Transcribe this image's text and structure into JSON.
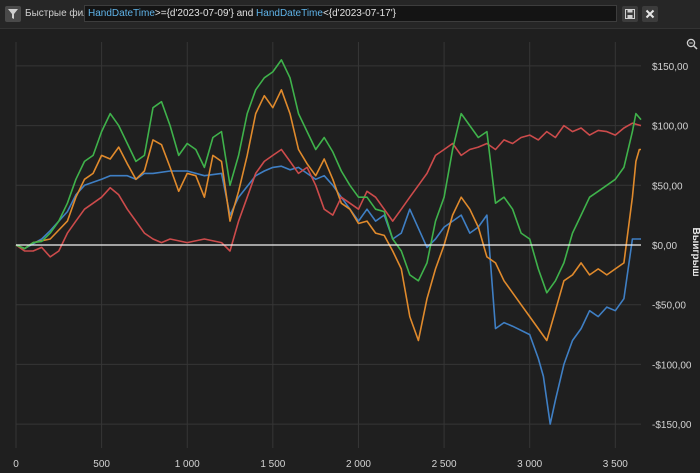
{
  "toolbar": {
    "filter_label": "Быстрые фильт",
    "query": {
      "field1": "HandDateTime",
      "op1": ">={d'2023-07-09'}",
      "conj": " and ",
      "field2": "HandDateTime",
      "op2": "<{d'2023-07-17'}"
    }
  },
  "icons": {
    "filter": "filter-icon",
    "save": "save-icon",
    "close": "close-icon",
    "zoom": "zoom-icon"
  },
  "chart_data": {
    "type": "line",
    "title": "",
    "xlabel": "",
    "ylabel": "Выигрыш",
    "xlim": [
      0,
      3650
    ],
    "ylim": [
      -170,
      170
    ],
    "grid": true,
    "x_ticks": [
      0,
      500,
      1000,
      1500,
      2000,
      2500,
      3000,
      3500
    ],
    "x_tick_labels": [
      "0",
      "500",
      "1 000",
      "1 500",
      "2 000",
      "2 500",
      "3 000",
      "3 500"
    ],
    "y_ticks": [
      150,
      100,
      50,
      0,
      -50,
      -100,
      -150
    ],
    "y_tick_labels": [
      "$150,00",
      "$100,00",
      "$50,00",
      "$0,00",
      "-$50,00",
      "-$100,00",
      "-$150,00"
    ],
    "zero_line": true,
    "series": [
      {
        "color": "#3f7fc4",
        "points": [
          [
            0,
            0
          ],
          [
            50,
            -3
          ],
          [
            150,
            5
          ],
          [
            200,
            12
          ],
          [
            300,
            28
          ],
          [
            350,
            42
          ],
          [
            400,
            50
          ],
          [
            500,
            55
          ],
          [
            550,
            58
          ],
          [
            650,
            58
          ],
          [
            700,
            55
          ],
          [
            750,
            60
          ],
          [
            800,
            60
          ],
          [
            900,
            62
          ],
          [
            1000,
            62
          ],
          [
            1100,
            58
          ],
          [
            1200,
            60
          ],
          [
            1250,
            25
          ],
          [
            1300,
            40
          ],
          [
            1400,
            58
          ],
          [
            1450,
            62
          ],
          [
            1500,
            65
          ],
          [
            1550,
            66
          ],
          [
            1600,
            63
          ],
          [
            1650,
            65
          ],
          [
            1700,
            60
          ],
          [
            1750,
            55
          ],
          [
            1800,
            58
          ],
          [
            1850,
            50
          ],
          [
            1900,
            40
          ],
          [
            2000,
            20
          ],
          [
            2050,
            30
          ],
          [
            2100,
            20
          ],
          [
            2150,
            25
          ],
          [
            2200,
            5
          ],
          [
            2250,
            10
          ],
          [
            2300,
            30
          ],
          [
            2400,
            -2
          ],
          [
            2450,
            5
          ],
          [
            2500,
            15
          ],
          [
            2600,
            25
          ],
          [
            2650,
            10
          ],
          [
            2700,
            15
          ],
          [
            2750,
            25
          ],
          [
            2800,
            -70
          ],
          [
            2850,
            -65
          ],
          [
            2900,
            -68
          ],
          [
            3000,
            -75
          ],
          [
            3050,
            -95
          ],
          [
            3080,
            -110
          ],
          [
            3120,
            -150
          ],
          [
            3150,
            -130
          ],
          [
            3200,
            -100
          ],
          [
            3250,
            -80
          ],
          [
            3300,
            -70
          ],
          [
            3350,
            -55
          ],
          [
            3400,
            -60
          ],
          [
            3450,
            -52
          ],
          [
            3500,
            -55
          ],
          [
            3550,
            -45
          ],
          [
            3600,
            5
          ],
          [
            3650,
            5
          ]
        ]
      },
      {
        "color": "#e08a2c",
        "points": [
          [
            0,
            0
          ],
          [
            50,
            -3
          ],
          [
            100,
            2
          ],
          [
            200,
            5
          ],
          [
            300,
            20
          ],
          [
            350,
            40
          ],
          [
            400,
            55
          ],
          [
            450,
            60
          ],
          [
            500,
            75
          ],
          [
            550,
            72
          ],
          [
            600,
            82
          ],
          [
            650,
            68
          ],
          [
            700,
            55
          ],
          [
            750,
            62
          ],
          [
            800,
            88
          ],
          [
            850,
            84
          ],
          [
            900,
            65
          ],
          [
            950,
            45
          ],
          [
            1000,
            60
          ],
          [
            1050,
            58
          ],
          [
            1100,
            40
          ],
          [
            1150,
            75
          ],
          [
            1200,
            70
          ],
          [
            1250,
            20
          ],
          [
            1300,
            45
          ],
          [
            1350,
            75
          ],
          [
            1400,
            110
          ],
          [
            1450,
            125
          ],
          [
            1500,
            115
          ],
          [
            1550,
            130
          ],
          [
            1600,
            110
          ],
          [
            1650,
            80
          ],
          [
            1700,
            68
          ],
          [
            1750,
            58
          ],
          [
            1800,
            72
          ],
          [
            1850,
            55
          ],
          [
            1900,
            35
          ],
          [
            1950,
            30
          ],
          [
            2000,
            18
          ],
          [
            2050,
            20
          ],
          [
            2100,
            10
          ],
          [
            2150,
            8
          ],
          [
            2200,
            -5
          ],
          [
            2250,
            -20
          ],
          [
            2300,
            -60
          ],
          [
            2350,
            -80
          ],
          [
            2400,
            -45
          ],
          [
            2450,
            -20
          ],
          [
            2500,
            0
          ],
          [
            2550,
            25
          ],
          [
            2600,
            40
          ],
          [
            2650,
            30
          ],
          [
            2700,
            15
          ],
          [
            2750,
            -10
          ],
          [
            2800,
            -15
          ],
          [
            2850,
            -30
          ],
          [
            2900,
            -40
          ],
          [
            2950,
            -50
          ],
          [
            3000,
            -60
          ],
          [
            3050,
            -70
          ],
          [
            3100,
            -80
          ],
          [
            3150,
            -55
          ],
          [
            3200,
            -30
          ],
          [
            3250,
            -25
          ],
          [
            3300,
            -15
          ],
          [
            3350,
            -25
          ],
          [
            3400,
            -20
          ],
          [
            3450,
            -25
          ],
          [
            3500,
            -20
          ],
          [
            3550,
            -15
          ],
          [
            3600,
            40
          ],
          [
            3620,
            70
          ],
          [
            3640,
            80
          ],
          [
            3650,
            80
          ]
        ]
      },
      {
        "color": "#cc4b4b",
        "points": [
          [
            0,
            0
          ],
          [
            50,
            -5
          ],
          [
            100,
            -5
          ],
          [
            150,
            -2
          ],
          [
            200,
            -10
          ],
          [
            250,
            -5
          ],
          [
            300,
            10
          ],
          [
            350,
            20
          ],
          [
            400,
            30
          ],
          [
            450,
            35
          ],
          [
            500,
            40
          ],
          [
            550,
            48
          ],
          [
            600,
            42
          ],
          [
            650,
            30
          ],
          [
            700,
            20
          ],
          [
            750,
            10
          ],
          [
            800,
            5
          ],
          [
            850,
            2
          ],
          [
            900,
            5
          ],
          [
            1000,
            2
          ],
          [
            1100,
            5
          ],
          [
            1200,
            2
          ],
          [
            1250,
            -5
          ],
          [
            1300,
            20
          ],
          [
            1350,
            40
          ],
          [
            1400,
            60
          ],
          [
            1450,
            70
          ],
          [
            1500,
            75
          ],
          [
            1550,
            80
          ],
          [
            1600,
            70
          ],
          [
            1650,
            60
          ],
          [
            1700,
            65
          ],
          [
            1750,
            50
          ],
          [
            1800,
            30
          ],
          [
            1850,
            25
          ],
          [
            1900,
            40
          ],
          [
            1950,
            35
          ],
          [
            2000,
            30
          ],
          [
            2050,
            45
          ],
          [
            2100,
            40
          ],
          [
            2150,
            30
          ],
          [
            2200,
            20
          ],
          [
            2250,
            30
          ],
          [
            2300,
            40
          ],
          [
            2350,
            50
          ],
          [
            2400,
            60
          ],
          [
            2450,
            75
          ],
          [
            2500,
            80
          ],
          [
            2550,
            85
          ],
          [
            2600,
            75
          ],
          [
            2650,
            80
          ],
          [
            2700,
            82
          ],
          [
            2750,
            85
          ],
          [
            2800,
            80
          ],
          [
            2850,
            88
          ],
          [
            2900,
            85
          ],
          [
            2950,
            90
          ],
          [
            3000,
            92
          ],
          [
            3050,
            88
          ],
          [
            3100,
            95
          ],
          [
            3150,
            90
          ],
          [
            3200,
            100
          ],
          [
            3250,
            95
          ],
          [
            3300,
            98
          ],
          [
            3350,
            92
          ],
          [
            3400,
            96
          ],
          [
            3450,
            95
          ],
          [
            3500,
            92
          ],
          [
            3550,
            98
          ],
          [
            3600,
            102
          ],
          [
            3650,
            100
          ]
        ]
      },
      {
        "color": "#3fb24b",
        "points": [
          [
            0,
            0
          ],
          [
            50,
            -3
          ],
          [
            100,
            2
          ],
          [
            150,
            3
          ],
          [
            200,
            10
          ],
          [
            250,
            20
          ],
          [
            300,
            35
          ],
          [
            350,
            55
          ],
          [
            400,
            70
          ],
          [
            450,
            75
          ],
          [
            500,
            95
          ],
          [
            550,
            110
          ],
          [
            600,
            100
          ],
          [
            650,
            85
          ],
          [
            700,
            70
          ],
          [
            750,
            75
          ],
          [
            800,
            115
          ],
          [
            850,
            120
          ],
          [
            900,
            100
          ],
          [
            950,
            75
          ],
          [
            1000,
            85
          ],
          [
            1050,
            80
          ],
          [
            1100,
            65
          ],
          [
            1150,
            90
          ],
          [
            1200,
            95
          ],
          [
            1250,
            50
          ],
          [
            1300,
            75
          ],
          [
            1350,
            110
          ],
          [
            1400,
            130
          ],
          [
            1450,
            140
          ],
          [
            1500,
            145
          ],
          [
            1550,
            155
          ],
          [
            1600,
            140
          ],
          [
            1650,
            110
          ],
          [
            1700,
            95
          ],
          [
            1750,
            80
          ],
          [
            1800,
            90
          ],
          [
            1850,
            78
          ],
          [
            1900,
            62
          ],
          [
            1950,
            50
          ],
          [
            2000,
            40
          ],
          [
            2050,
            40
          ],
          [
            2100,
            30
          ],
          [
            2150,
            28
          ],
          [
            2200,
            5
          ],
          [
            2250,
            -5
          ],
          [
            2300,
            -25
          ],
          [
            2350,
            -30
          ],
          [
            2400,
            -15
          ],
          [
            2450,
            20
          ],
          [
            2500,
            40
          ],
          [
            2550,
            80
          ],
          [
            2600,
            110
          ],
          [
            2650,
            100
          ],
          [
            2700,
            90
          ],
          [
            2750,
            95
          ],
          [
            2800,
            35
          ],
          [
            2850,
            40
          ],
          [
            2900,
            30
          ],
          [
            2950,
            10
          ],
          [
            3000,
            5
          ],
          [
            3050,
            -20
          ],
          [
            3100,
            -40
          ],
          [
            3150,
            -30
          ],
          [
            3200,
            -15
          ],
          [
            3250,
            10
          ],
          [
            3300,
            25
          ],
          [
            3350,
            40
          ],
          [
            3400,
            45
          ],
          [
            3450,
            50
          ],
          [
            3500,
            55
          ],
          [
            3550,
            65
          ],
          [
            3600,
            95
          ],
          [
            3620,
            110
          ],
          [
            3650,
            105
          ]
        ]
      }
    ]
  }
}
